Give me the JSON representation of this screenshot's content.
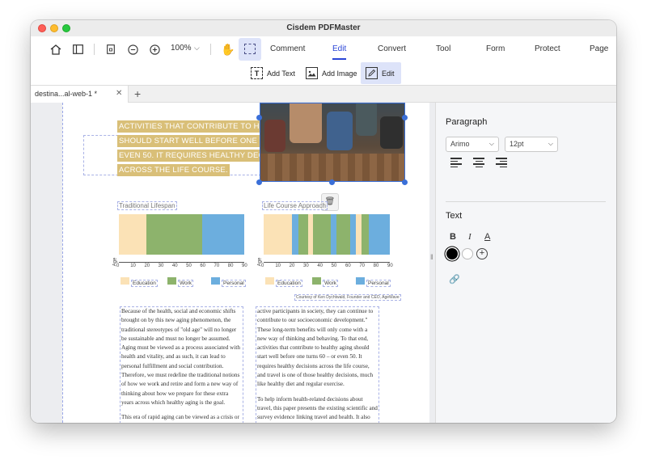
{
  "window": {
    "title": "Cisdem PDFMaster"
  },
  "toolbar": {
    "zoom": "100%",
    "tabs": [
      {
        "label": "Comment"
      },
      {
        "label": "Edit"
      },
      {
        "label": "Convert"
      },
      {
        "label": "Tool"
      },
      {
        "label": "Form"
      },
      {
        "label": "Protect"
      },
      {
        "label": "Page"
      }
    ],
    "active_tab": "Edit"
  },
  "subtoolbar": {
    "add_text": "Add Text",
    "add_image": "Add Image",
    "edit": "Edit"
  },
  "doc_tab": {
    "label": "destina...al-web-1 *"
  },
  "page": {
    "highlight_lines": [
      "ACTIVITIES THAT CONTRIBUTE TO HEALTHY AGING",
      "SHOULD START WELL BEFORE ONE TURNS 60 – OR",
      "EVEN 50. IT REQUIRES HEALTHY DECISIONS",
      "ACROSS THE LIFE COURSE."
    ],
    "column_left": [
      "Because of the health, social and economic shifts brought on by this new aging phenomenon, the traditional stereotypes of \"old age\" will no longer be sustainable and must no longer be assumed. Aging must be viewed as a process associated with health and vitality, and as such, it can lead to personal fulfillment and social contribution. Therefore, we must redefine the traditional notions of how we work and retire and form a new way of thinking about how we prepare for these extra years across which healthy aging is the goal.",
      "This era of rapid aging can be viewed as a crisis or an opportunity. Through the lens of opportunity, we can uncover new paths to economic growth, social"
    ],
    "column_right": [
      "active participants in society, they can continue to contribute to our socioeconomic development.\" These long-term benefits will only come with a new way of thinking and behaving. To that end, activities that contribute to healthy aging should start well before one turns 60 – or even 50. It requires healthy decisions across the life course, and travel is one of those healthy decisions, much like healthy diet and regular exercise.",
      "To help inform health-related decisions about travel, this paper presents the existing scientific and survey evidence linking travel and health. It also further"
    ],
    "courtesy": "Courtesy of Ken Dychtwald, Founder and CEO, AgeWave"
  },
  "chart_data": [
    {
      "type": "bar",
      "title": "Traditional Lifespan",
      "orientation": "horizontal-stacked",
      "segments": [
        {
          "name": "Education",
          "start": 0,
          "end": 20,
          "color": "#fbe2b6"
        },
        {
          "name": "Work",
          "start": 20,
          "end": 60,
          "color": "#8db36c"
        },
        {
          "name": "Personal",
          "start": 60,
          "end": 90,
          "color": "#6caede"
        }
      ],
      "xlabel": "Age",
      "xlim": [
        0,
        90
      ],
      "ticks": [
        "0",
        "10",
        "20",
        "30",
        "40",
        "50",
        "60",
        "70",
        "80",
        "90"
      ],
      "legend": [
        "Education",
        "Work",
        "Personal"
      ]
    },
    {
      "type": "bar",
      "title": "Life Course Approach",
      "orientation": "horizontal-stacked",
      "segments": [
        {
          "name": "Education",
          "start": 0,
          "end": 20,
          "color": "#fbe2b6"
        },
        {
          "name": "Personal",
          "start": 20,
          "end": 25,
          "color": "#6caede"
        },
        {
          "name": "Work",
          "start": 25,
          "end": 32,
          "color": "#8db36c"
        },
        {
          "name": "Education",
          "start": 32,
          "end": 35,
          "color": "#fbe2b6"
        },
        {
          "name": "Work",
          "start": 35,
          "end": 48,
          "color": "#8db36c"
        },
        {
          "name": "Personal",
          "start": 48,
          "end": 52,
          "color": "#6caede"
        },
        {
          "name": "Work",
          "start": 52,
          "end": 62,
          "color": "#8db36c"
        },
        {
          "name": "Personal",
          "start": 62,
          "end": 66,
          "color": "#6caede"
        },
        {
          "name": "Education",
          "start": 66,
          "end": 70,
          "color": "#fbe2b6"
        },
        {
          "name": "Work",
          "start": 70,
          "end": 75,
          "color": "#8db36c"
        },
        {
          "name": "Personal",
          "start": 75,
          "end": 90,
          "color": "#6caede"
        }
      ],
      "xlabel": "Age",
      "xlim": [
        0,
        90
      ],
      "ticks": [
        "0",
        "10",
        "20",
        "30",
        "40",
        "50",
        "60",
        "70",
        "80",
        "90"
      ],
      "legend": [
        "Education",
        "Work",
        "Personal"
      ]
    }
  ],
  "right_panel": {
    "paragraph_title": "Paragraph",
    "font": "Arimo",
    "size": "12pt",
    "text_title": "Text",
    "bold": "B",
    "italic": "I",
    "underline": "A",
    "colors": {
      "black": "#000000",
      "white": "#ffffff"
    }
  },
  "icons": [
    "home-icon",
    "sidebar-icon",
    "page-icon",
    "zoom-out-icon",
    "zoom-in-icon",
    "hand-icon",
    "select-icon",
    "text-icon",
    "image-icon",
    "edit-icon",
    "trash-icon",
    "link-icon",
    "plus-icon",
    "close-icon"
  ]
}
